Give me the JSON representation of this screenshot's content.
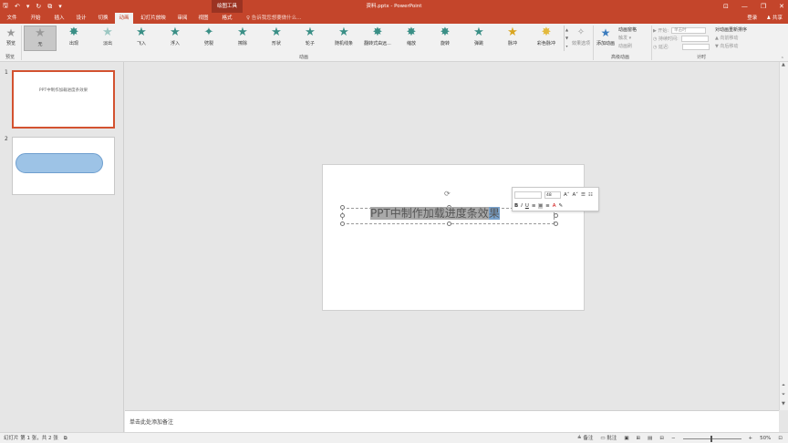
{
  "titlebar": {
    "qat": {
      "save": "🖫",
      "undo": "↶",
      "undo_dd": "▾",
      "redo": "↻",
      "present": "⧉",
      "customize": "▾"
    },
    "context_tab": "绘图工具",
    "title": "资料.pptx - PowerPoint",
    "win": {
      "ribbon_opts": "⊡",
      "minimize": "—",
      "restore": "❐",
      "close": "✕"
    }
  },
  "tabs": {
    "items": [
      {
        "label": "文件"
      },
      {
        "label": "开始"
      },
      {
        "label": "插入"
      },
      {
        "label": "设计"
      },
      {
        "label": "切换"
      },
      {
        "label": "动画"
      },
      {
        "label": "幻灯片放映"
      },
      {
        "label": "审阅"
      },
      {
        "label": "视图"
      },
      {
        "label": "格式"
      }
    ],
    "tellme": "♀ 告诉我您想要做什么...",
    "signin": "登录",
    "share": "♟ 共享"
  },
  "ribbon": {
    "preview_label": "预览",
    "preview_group": "预览",
    "animations": [
      {
        "label": "无",
        "icon": "★"
      },
      {
        "label": "出现",
        "icon": "✸"
      },
      {
        "label": "淡出",
        "icon": "★"
      },
      {
        "label": "飞入",
        "icon": "★"
      },
      {
        "label": "浮入",
        "icon": "★"
      },
      {
        "label": "劈裂",
        "icon": "✦"
      },
      {
        "label": "擦除",
        "icon": "★"
      },
      {
        "label": "形状",
        "icon": "★"
      },
      {
        "label": "轮子",
        "icon": "★"
      },
      {
        "label": "随机线条",
        "icon": "★"
      },
      {
        "label": "翻转式由远...",
        "icon": "✸"
      },
      {
        "label": "缩放",
        "icon": "✸"
      },
      {
        "label": "旋转",
        "icon": "✸"
      },
      {
        "label": "弹跳",
        "icon": "★"
      },
      {
        "label": "脉冲",
        "icon": "★"
      },
      {
        "label": "彩色脉冲",
        "icon": "✸"
      }
    ],
    "anim_group": "动画",
    "effect_options": "效果选项",
    "add_animation": "添加动画",
    "animation_pane": "动画窗格",
    "trigger": "触发 ▾",
    "painter": "动画刷",
    "advanced_group": "高级动画",
    "timing": {
      "start_label": "▶ 开始:",
      "start_value": "单击时",
      "duration_label": "◷ 持续时间:",
      "duration_value": "",
      "delay_label": "◷ 延迟:",
      "delay_value": ""
    },
    "reorder_title": "对动画重新排序",
    "move_earlier": "▲ 向前移动",
    "move_later": "▼ 向后移动",
    "timing_group": "计时"
  },
  "thumbnails": [
    {
      "number": "1",
      "text": "PPT中制作加载进度条效果"
    },
    {
      "number": "2",
      "text": ""
    }
  ],
  "slide": {
    "text_before": "PPT中制作加载进度条效",
    "text_selected": "果"
  },
  "minitoolbar": {
    "font": "",
    "size": "48",
    "grow": "A˄",
    "shrink": "A˅",
    "bold": "B",
    "italic": "I",
    "underline": "U",
    "font_color": "A"
  },
  "notes": {
    "placeholder": "单击此处添加备注"
  },
  "status": {
    "slide_info": "幻灯片 第 1 张，共 2 张",
    "lang_icon": "⧉",
    "notes_btn": "≜ 备注",
    "comments_btn": "▭ 批注",
    "zoom_out": "−",
    "zoom_in": "+",
    "zoom": "50%",
    "fit": "⊡"
  }
}
